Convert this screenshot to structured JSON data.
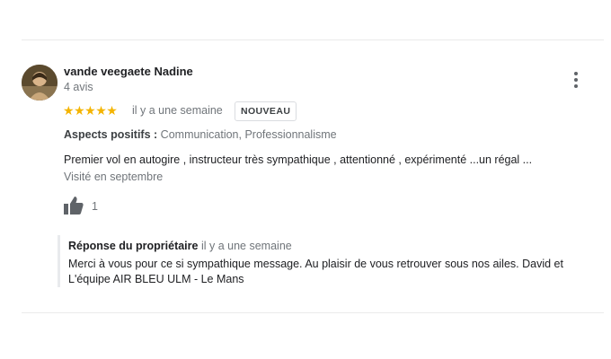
{
  "review": {
    "author": "vande veegaete Nadine",
    "review_count": "4 avis",
    "rating": 5,
    "time": "il y a une semaine",
    "badge": "NOUVEAU",
    "aspects_label": "Aspects positifs :",
    "aspects_values": "Communication, Professionnalisme",
    "text": "Premier vol en autogire  , instructeur très sympathique  , attentionné  , expérimenté  ...un régal  ...",
    "visited": "Visité en septembre",
    "likes": "1",
    "menu_icon": "more-vert-icon",
    "like_icon": "thumb-up-icon",
    "star_color": "#f4b400"
  },
  "owner_reply": {
    "label": "Réponse du propriétaire",
    "time": "il y a une semaine",
    "text": "Merci à vous pour ce si sympathique message. Au plaisir de vous retrouver sous nos ailes. David et L'équipe AIR BLEU ULM - Le Mans"
  }
}
